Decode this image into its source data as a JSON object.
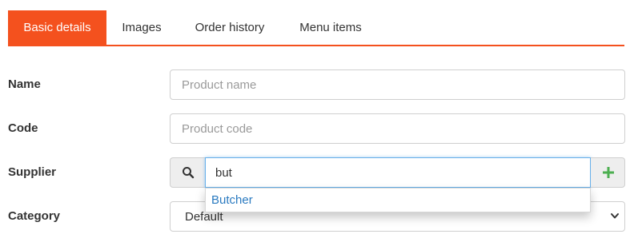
{
  "tabs": [
    {
      "label": "Basic details",
      "active": true
    },
    {
      "label": "Images",
      "active": false
    },
    {
      "label": "Order history",
      "active": false
    },
    {
      "label": "Menu items",
      "active": false
    }
  ],
  "form": {
    "name": {
      "label": "Name",
      "placeholder": "Product name",
      "value": ""
    },
    "code": {
      "label": "Code",
      "placeholder": "Product code",
      "value": ""
    },
    "supplier": {
      "label": "Supplier",
      "value": "but",
      "search_icon": "search-icon",
      "add_icon": "plus-icon",
      "suggestions": [
        "Butcher"
      ]
    },
    "category": {
      "label": "Category",
      "selected": "Default"
    }
  },
  "colors": {
    "accent": "#f4511e",
    "link": "#2a7ac0",
    "add_green": "#4caf50"
  }
}
